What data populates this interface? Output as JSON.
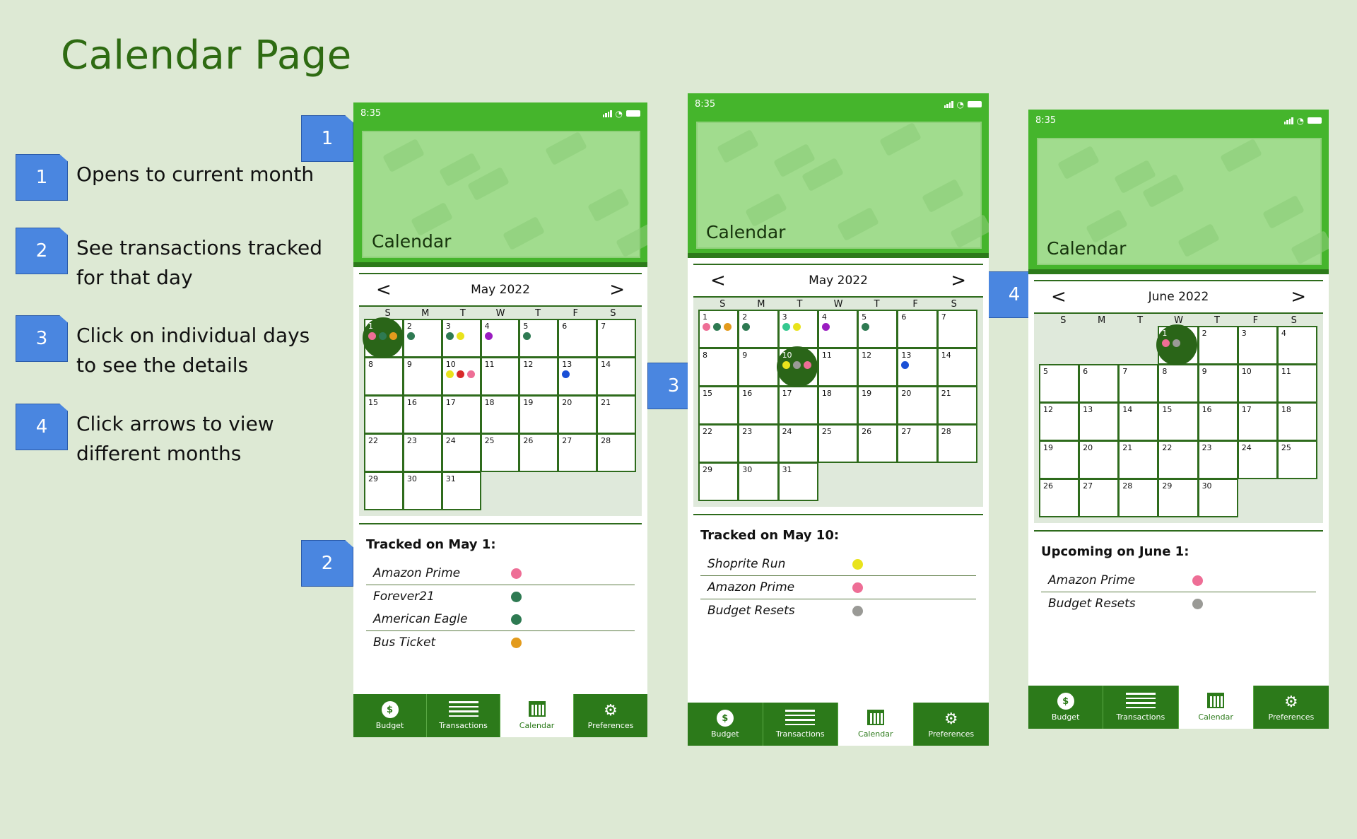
{
  "page_title": "Calendar Page",
  "colors": {
    "pink": "#ee6e96",
    "green": "#2e7a52",
    "orange": "#e39b1d",
    "yellow": "#e9e31c",
    "purple": "#9a1cc0",
    "blue": "#1a4fd6",
    "red": "#d82a2a",
    "gray": "#9a9a96",
    "teal": "#35c890"
  },
  "legend": [
    {
      "num": "1",
      "text": "Opens to current month"
    },
    {
      "num": "2",
      "text": "See transactions tracked for that day"
    },
    {
      "num": "3",
      "text": "Click on individual days to see the details"
    },
    {
      "num": "4",
      "text": "Click arrows to view different months"
    }
  ],
  "callouts": {
    "c1": "1",
    "c2": "2",
    "c3": "3",
    "c4": "4"
  },
  "common": {
    "time": "8:35",
    "hero_title": "Calendar",
    "prev": "<",
    "next": ">",
    "dow": [
      "S",
      "M",
      "T",
      "W",
      "T",
      "F",
      "S"
    ],
    "tabs": {
      "budget": "Budget",
      "transactions": "Transactions",
      "calendar": "Calendar",
      "preferences": "Preferences",
      "coin": "$"
    }
  },
  "screens": [
    {
      "month": "May 2022",
      "offset": 0,
      "days": 31,
      "selected": 1,
      "dots": {
        "1": [
          "pink",
          "green",
          "orange"
        ],
        "2": [
          "green"
        ],
        "3": [
          "green",
          "yellow"
        ],
        "4": [
          "purple"
        ],
        "5": [
          "green"
        ],
        "10": [
          "yellow",
          "red",
          "pink"
        ],
        "13": [
          "blue"
        ]
      },
      "tracked_title": "Tracked on May 1:",
      "tracked": [
        [
          {
            "name": "Amazon Prime",
            "color": "pink"
          }
        ],
        [
          {
            "name": "Forever21",
            "color": "green"
          },
          {
            "name": "American Eagle",
            "color": "green"
          }
        ],
        [
          {
            "name": "Bus Ticket",
            "color": "orange"
          }
        ]
      ]
    },
    {
      "month": "May 2022",
      "offset": 0,
      "days": 31,
      "selected": 10,
      "dots": {
        "1": [
          "pink",
          "green",
          "orange"
        ],
        "2": [
          "green"
        ],
        "3": [
          "teal",
          "yellow"
        ],
        "4": [
          "purple"
        ],
        "5": [
          "green"
        ],
        "10": [
          "yellow",
          "gray",
          "pink"
        ],
        "13": [
          "blue"
        ]
      },
      "tracked_title": "Tracked on May 10:",
      "tracked": [
        [
          {
            "name": "Shoprite Run",
            "color": "yellow"
          }
        ],
        [
          {
            "name": "Amazon Prime",
            "color": "pink"
          }
        ],
        [
          {
            "name": "Budget Resets",
            "color": "gray"
          }
        ]
      ]
    },
    {
      "month": "June 2022",
      "offset": 3,
      "days": 30,
      "selected": 1,
      "dots": {
        "1": [
          "pink",
          "gray"
        ]
      },
      "tracked_title": "Upcoming on June 1:",
      "tracked": [
        [
          {
            "name": "Amazon Prime",
            "color": "pink"
          }
        ],
        [
          {
            "name": "Budget Resets",
            "color": "gray"
          }
        ]
      ]
    }
  ]
}
